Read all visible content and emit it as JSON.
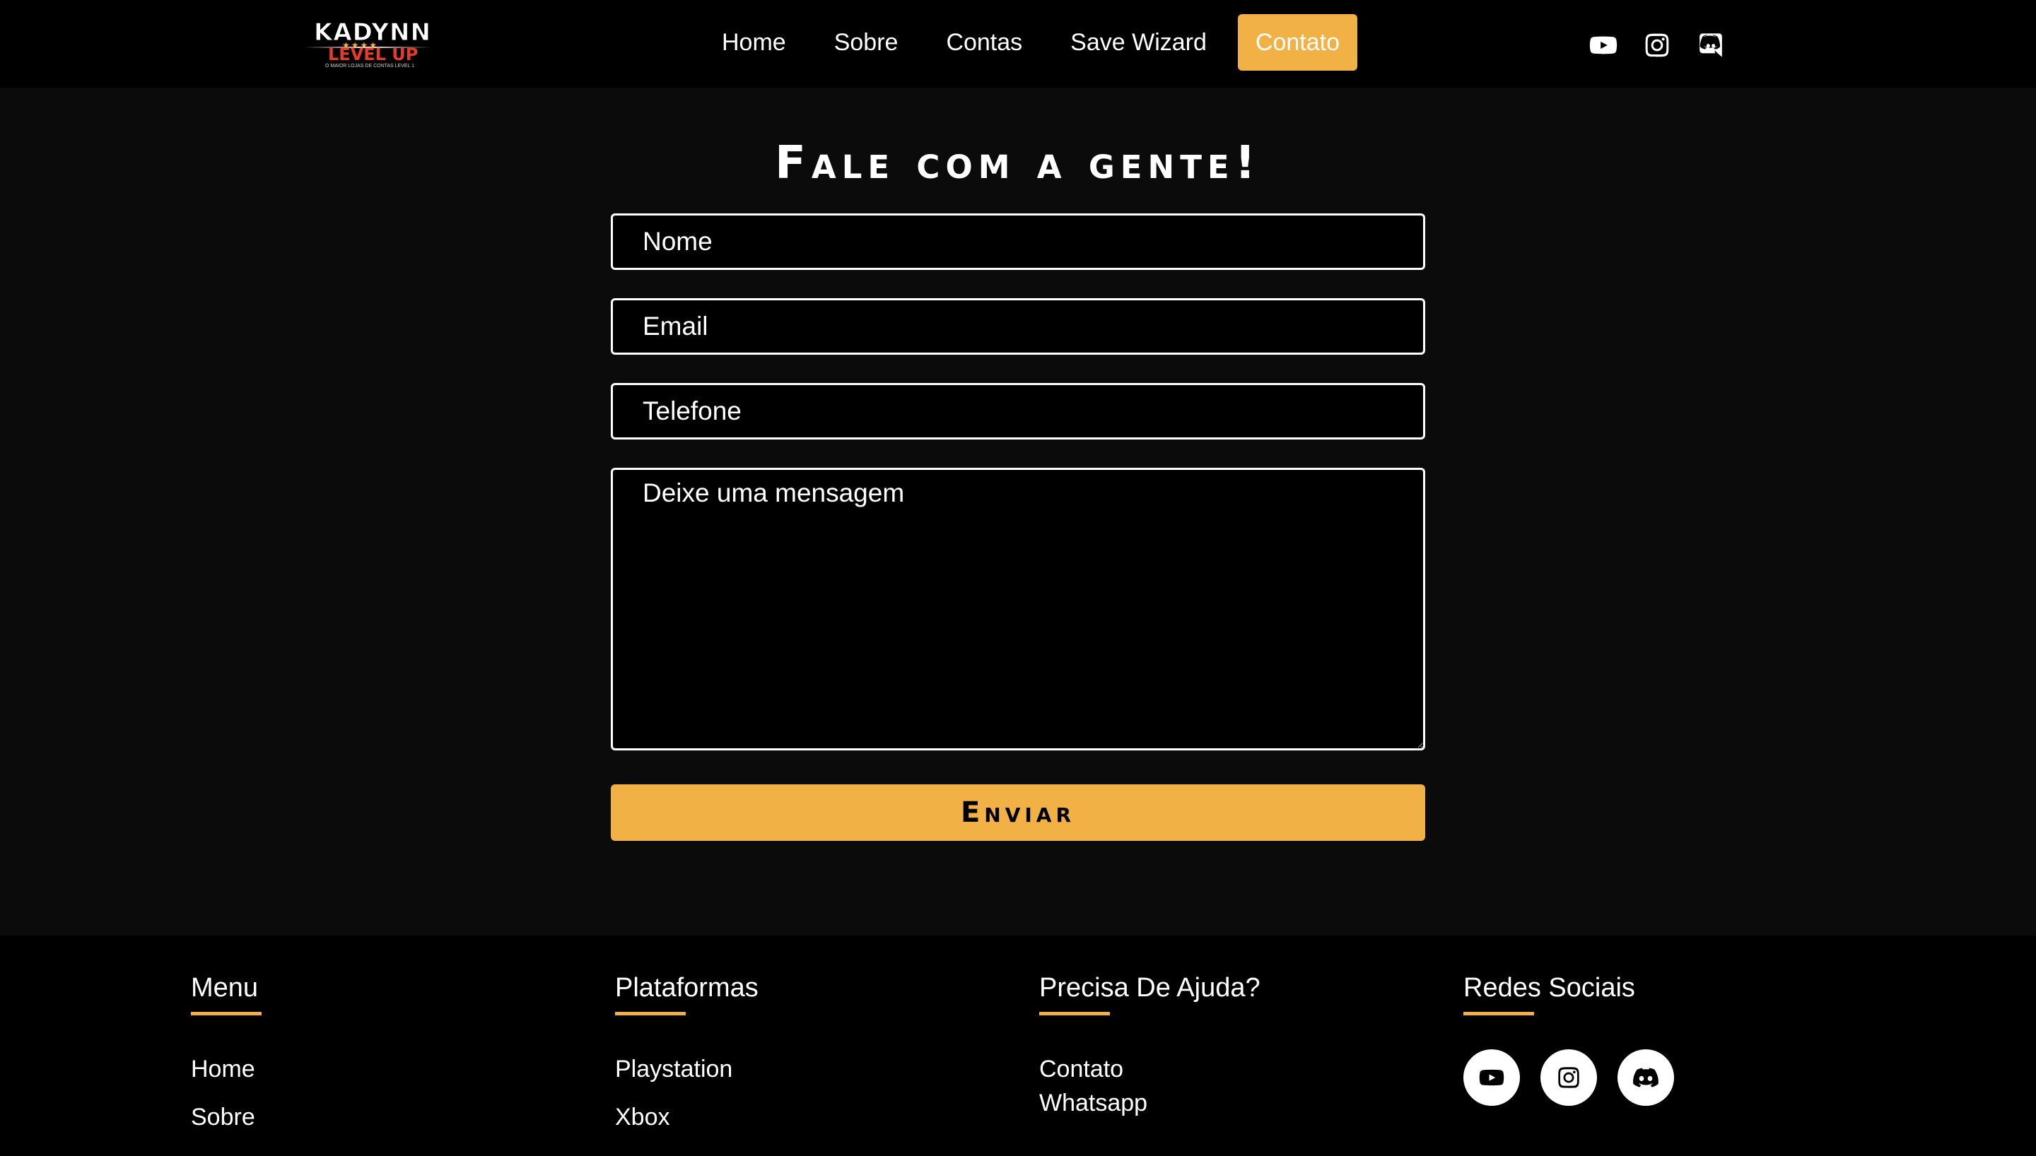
{
  "brand": {
    "logo_line1": "KADYNN",
    "logo_line2": "LEVEL UP",
    "logo_tagline": "O MAIOR LOJAS DE CONTAS LEVEL 1",
    "accent_color": "#f2b144",
    "logo_red": "#e33c2c"
  },
  "nav": {
    "items": [
      {
        "label": "Home",
        "active": false
      },
      {
        "label": "Sobre",
        "active": false
      },
      {
        "label": "Contas",
        "active": false
      },
      {
        "label": "Save Wizard",
        "active": false
      },
      {
        "label": "Contato",
        "active": true
      }
    ],
    "social_icons": [
      "youtube-icon",
      "instagram-icon",
      "discord-icon"
    ]
  },
  "contact": {
    "heading": "Fale com a gente!",
    "name_placeholder": "Nome",
    "email_placeholder": "Email",
    "phone_placeholder": "Telefone",
    "message_placeholder": "Deixe uma mensagem",
    "submit_label": "Enviar"
  },
  "footer": {
    "menu": {
      "title": "Menu",
      "links": [
        "Home",
        "Sobre"
      ]
    },
    "platforms": {
      "title": "Plataformas",
      "links": [
        "Playstation",
        "Xbox"
      ]
    },
    "help": {
      "title": "Precisa De Ajuda?",
      "links": [
        "Contato",
        "Whatsapp"
      ]
    },
    "social": {
      "title": "Redes Sociais",
      "icons": [
        "youtube-icon",
        "instagram-icon",
        "discord-icon"
      ]
    }
  }
}
